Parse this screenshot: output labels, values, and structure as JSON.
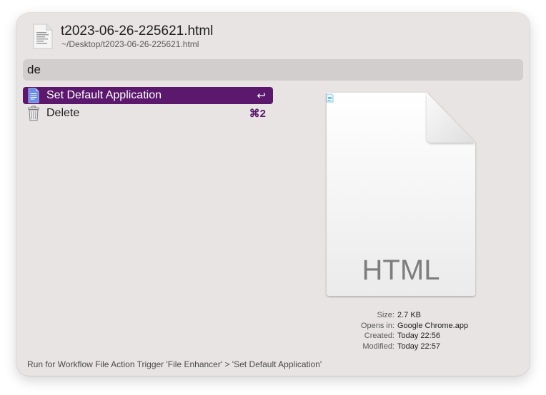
{
  "header": {
    "title": "t2023-06-26-225621.html",
    "path": "~/Desktop/t2023-06-26-225621.html",
    "icon": "html-file-icon"
  },
  "search": {
    "query": "de"
  },
  "results": [
    {
      "label": "Set Default Application",
      "shortcut": "↩",
      "icon": "document-icon",
      "selected": true
    },
    {
      "label": "Delete",
      "shortcut": "⌘2",
      "icon": "trash-icon",
      "selected": false
    }
  ],
  "preview": {
    "badge": "HTML",
    "icon": "html-file-icon"
  },
  "metadata": [
    {
      "key": "Size:",
      "value": "2.7 KB"
    },
    {
      "key": "Opens in:",
      "value": "Google Chrome.app"
    },
    {
      "key": "Created:",
      "value": "Today 22:56"
    },
    {
      "key": "Modified:",
      "value": "Today 22:57"
    }
  ],
  "footer": {
    "text": "Run for Workflow File Action Trigger 'File Enhancer' > 'Set Default Application'"
  },
  "colors": {
    "accent": "#5b186c",
    "window_bg": "#e8e4e3",
    "search_bg": "#d2cecd"
  }
}
